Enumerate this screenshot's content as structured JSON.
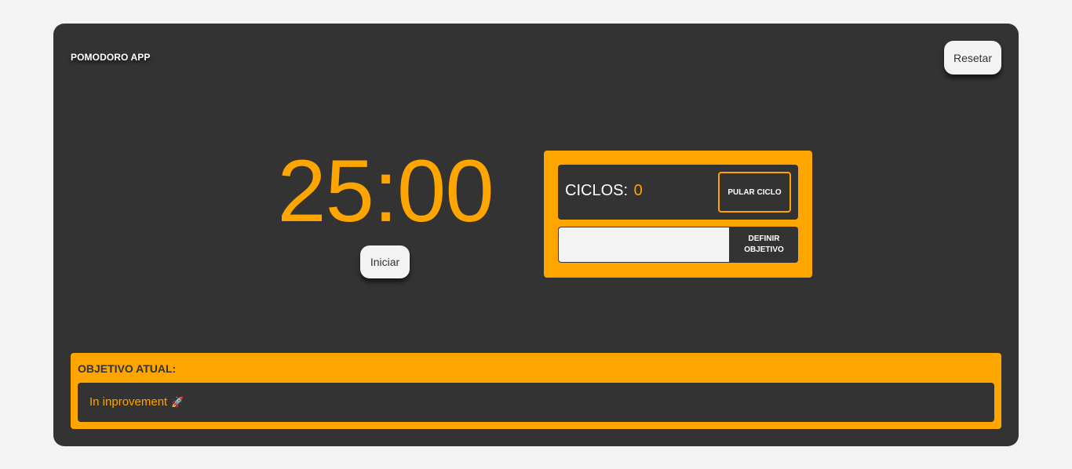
{
  "header": {
    "brand": "POMODORO APP",
    "reset_label": "Resetar"
  },
  "timer": {
    "display": "25:00",
    "start_label": "Iniciar"
  },
  "cycles": {
    "label": "CICLOS:",
    "count": "0",
    "skip_label": "PULAR CICLO"
  },
  "goal_form": {
    "input_value": "",
    "input_placeholder": "",
    "define_label": "DEFINIR OBJETIVO"
  },
  "current_goal": {
    "label": "OBJETIVO ATUAL:",
    "text": "In inprovement",
    "icon": "rocket-icon",
    "icon_glyph": "🚀"
  },
  "colors": {
    "background": "#f3f3f3",
    "card": "#333333",
    "accent": "#ffa500",
    "text_light": "#ffffff"
  }
}
